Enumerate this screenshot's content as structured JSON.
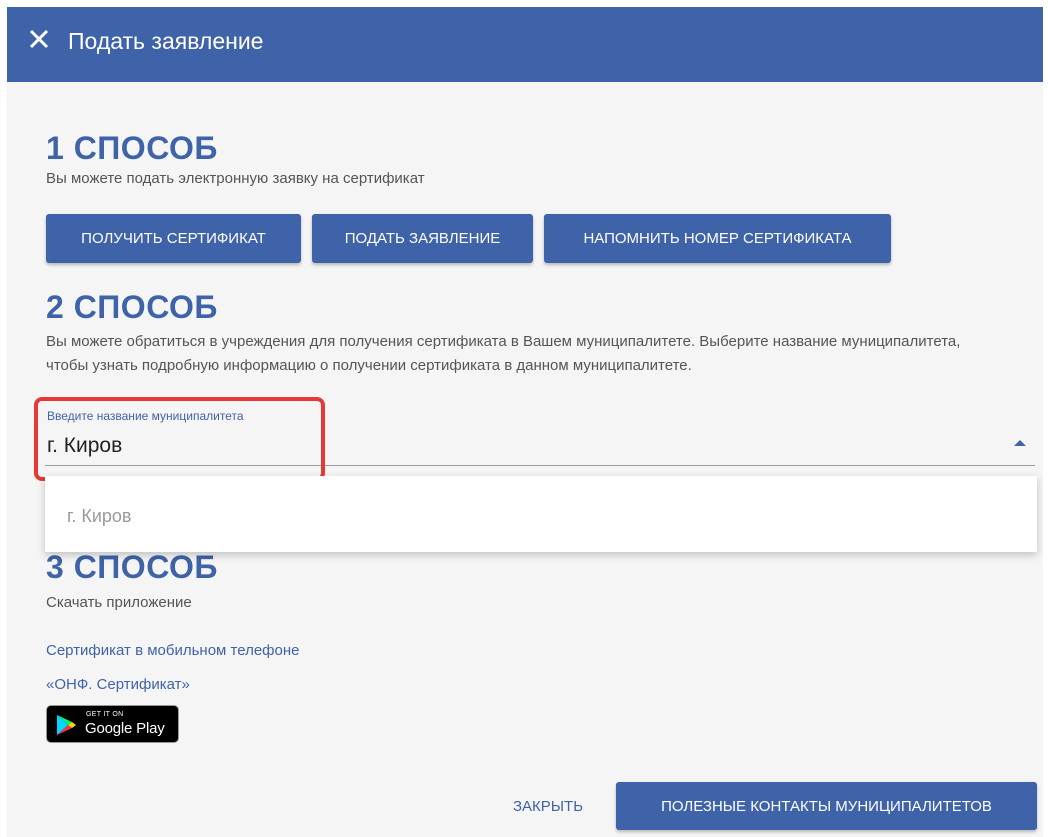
{
  "window": {
    "title": "Подать заявление",
    "close_icon": "close-icon"
  },
  "method1": {
    "heading": "1 СПОСОБ",
    "description": "Вы можете подать электронную заявку на сертификат",
    "buttons": [
      {
        "label": "ПОЛУЧИТЬ СЕРТИФИКАТ"
      },
      {
        "label": "ПОДАТЬ ЗАЯВЛЕНИЕ"
      },
      {
        "label": "НАПОМНИТЬ НОМЕР СЕРТИФИКАТА"
      }
    ]
  },
  "method2": {
    "heading": "2 СПОСОБ",
    "description": "Вы можете обратиться в учреждения для получения сертификата в Вашем муниципалитете. Выберите название муниципалитета, чтобы узнать подробную информацию о получении сертификата в данном муниципалитете.",
    "field": {
      "label": "Введите название муниципалитета",
      "value": "г. Киров",
      "dropdown_icon": "caret-up-icon"
    },
    "dropdown_options": [
      "г. Киров"
    ]
  },
  "method3": {
    "heading": "3 СПОСОБ",
    "description": "Скачать приложение",
    "link1": "Сертификат в мобильном телефоне",
    "link2": "«ОНФ. Сертификат»",
    "store_badge": {
      "small_text": "GET IT ON",
      "big_text": "Google Play",
      "icon": "google-play-icon"
    }
  },
  "footer": {
    "close_label": "ЗАКРЫТЬ",
    "contacts_label": "ПОЛЕЗНЫЕ КОНТАКТЫ МУНИЦИПАЛИТЕТОВ"
  },
  "colors": {
    "primary": "#3f63a8",
    "highlight": "#e53935",
    "background": "#f5f5f5"
  }
}
